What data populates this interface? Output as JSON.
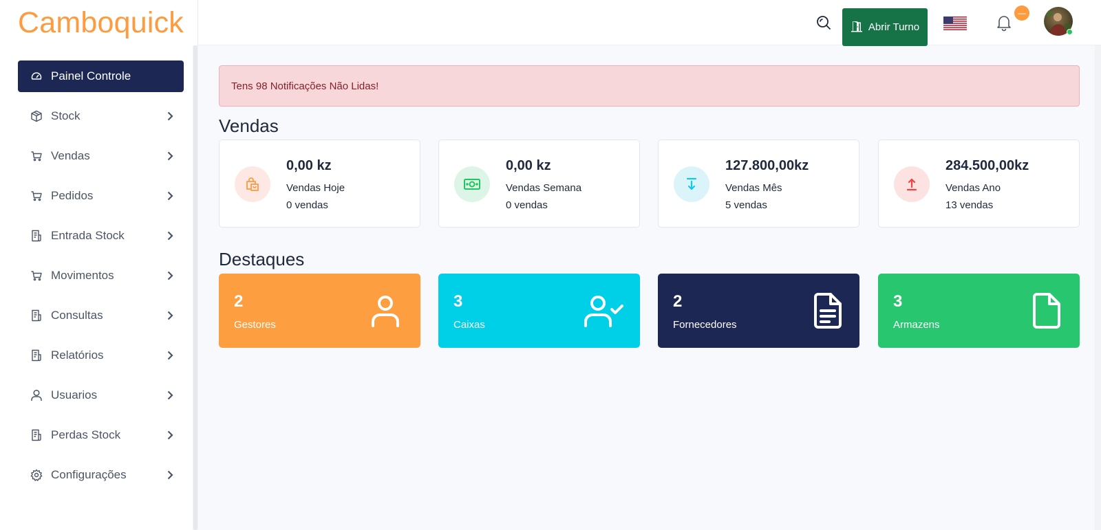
{
  "app": {
    "brand": "Camboquick"
  },
  "sidebar": {
    "items": [
      {
        "label": "Painel Controle",
        "icon": "dashboard-icon",
        "active": true
      },
      {
        "label": "Stock",
        "icon": "box-icon"
      },
      {
        "label": "Vendas",
        "icon": "cart-icon"
      },
      {
        "label": "Pedidos",
        "icon": "cart-icon"
      },
      {
        "label": "Entrada Stock",
        "icon": "receipt-icon"
      },
      {
        "label": "Movimentos",
        "icon": "cart-icon"
      },
      {
        "label": "Consultas",
        "icon": "receipt-icon"
      },
      {
        "label": "Relatórios",
        "icon": "receipt-icon"
      },
      {
        "label": "Usuarios",
        "icon": "user-icon"
      },
      {
        "label": "Perdas Stock",
        "icon": "receipt-icon"
      },
      {
        "label": "Configurações",
        "icon": "gear-icon"
      }
    ]
  },
  "header": {
    "open_shift_label": "Abrir Turno",
    "notification_badge": "—"
  },
  "alert": {
    "text": "Tens 98 Notificações Não Lidas!"
  },
  "sales": {
    "title": "Vendas",
    "cards": [
      {
        "amount": "0,00 kz",
        "label": "Vendas Hoje",
        "count": "0 vendas",
        "icon": "shopping-bag-icon",
        "color": "#fd9b3f",
        "bg": "#fde8e4"
      },
      {
        "amount": "0,00 kz",
        "label": "Vendas Semana",
        "count": "0 vendas",
        "icon": "money-icon",
        "color": "#22c55e",
        "bg": "#dcf5e7"
      },
      {
        "amount": "127.800,00kz",
        "label": "Vendas Mês",
        "count": "5 vendas",
        "icon": "download-icon",
        "color": "#0dcaf0",
        "bg": "#dbf4fa"
      },
      {
        "amount": "284.500,00kz",
        "label": "Vendas Ano",
        "count": "13 vendas",
        "icon": "upload-icon",
        "color": "#ef4444",
        "bg": "#fde2e2"
      }
    ]
  },
  "highlights": {
    "title": "Destaques",
    "cards": [
      {
        "value": "2",
        "label": "Gestores",
        "icon": "user-icon",
        "color": "#fd9f41"
      },
      {
        "value": "3",
        "label": "Caixas",
        "icon": "user-check-icon",
        "color": "#00cfe8"
      },
      {
        "value": "2",
        "label": "Fornecedores",
        "icon": "document-text-icon",
        "color": "#1c2753"
      },
      {
        "value": "3",
        "label": "Armazens",
        "icon": "file-icon",
        "color": "#28c76f"
      }
    ]
  }
}
